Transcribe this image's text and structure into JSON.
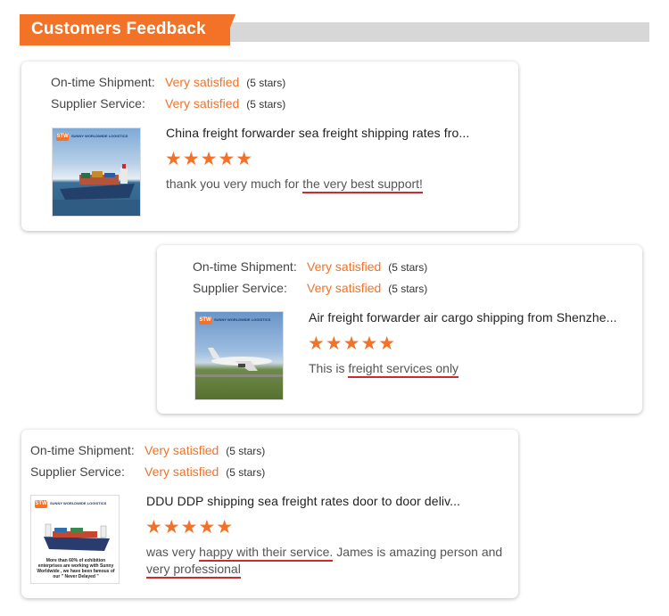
{
  "header": {
    "title": "Customers Feedback"
  },
  "logo_text": "SUNNY WORLDWIDE LOGISTICS",
  "colors": {
    "accent": "#f27228",
    "underline": "#d0282d",
    "bar": "#d7d7d7"
  },
  "reviews": [
    {
      "shipment_label": "On-time Shipment:",
      "shipment_value": "Very satisfied",
      "shipment_count": "(5 stars)",
      "service_label": "Supplier Service:",
      "service_value": "Very satisfied",
      "service_count": "(5 stars)",
      "product_title": "China freight forwarder sea freight shipping rates fro...",
      "rating": 5,
      "stars": "★★★★★",
      "comment_plain": "thank you very much for ",
      "comment_highlight": "the very best support!",
      "thumb": "ship-icon"
    },
    {
      "shipment_label": "On-time Shipment:",
      "shipment_value": "Very satisfied",
      "shipment_count": "(5 stars)",
      "service_label": "Supplier Service:",
      "service_value": "Very satisfied",
      "service_count": "(5 stars)",
      "product_title": "Air freight forwarder air cargo shipping from Shenzhe...",
      "rating": 5,
      "stars": "★★★★★",
      "comment_plain": "This is ",
      "comment_highlight": "freight services only",
      "thumb": "airplane-icon"
    },
    {
      "shipment_label": "On-time Shipment:",
      "shipment_value": "Very satisfied",
      "shipment_count": "(5 stars)",
      "service_label": "Supplier Service:",
      "service_value": "Very satisfied",
      "service_count": "(5 stars)",
      "product_title": "DDU DDP shipping sea freight rates door to door deliv...",
      "rating": 5,
      "stars": "★★★★★",
      "comment_part1": "was very ",
      "comment_highlight1": "happy with their service.",
      "comment_part2": " James is amazing person and ",
      "comment_highlight2": "very professional",
      "thumb_caption": "More than 60% of exhibition enterprises are working with Sunny Worldwide , we have been famous of our \" Never Delayed \"",
      "thumb": "cargo-ship-icon"
    }
  ]
}
